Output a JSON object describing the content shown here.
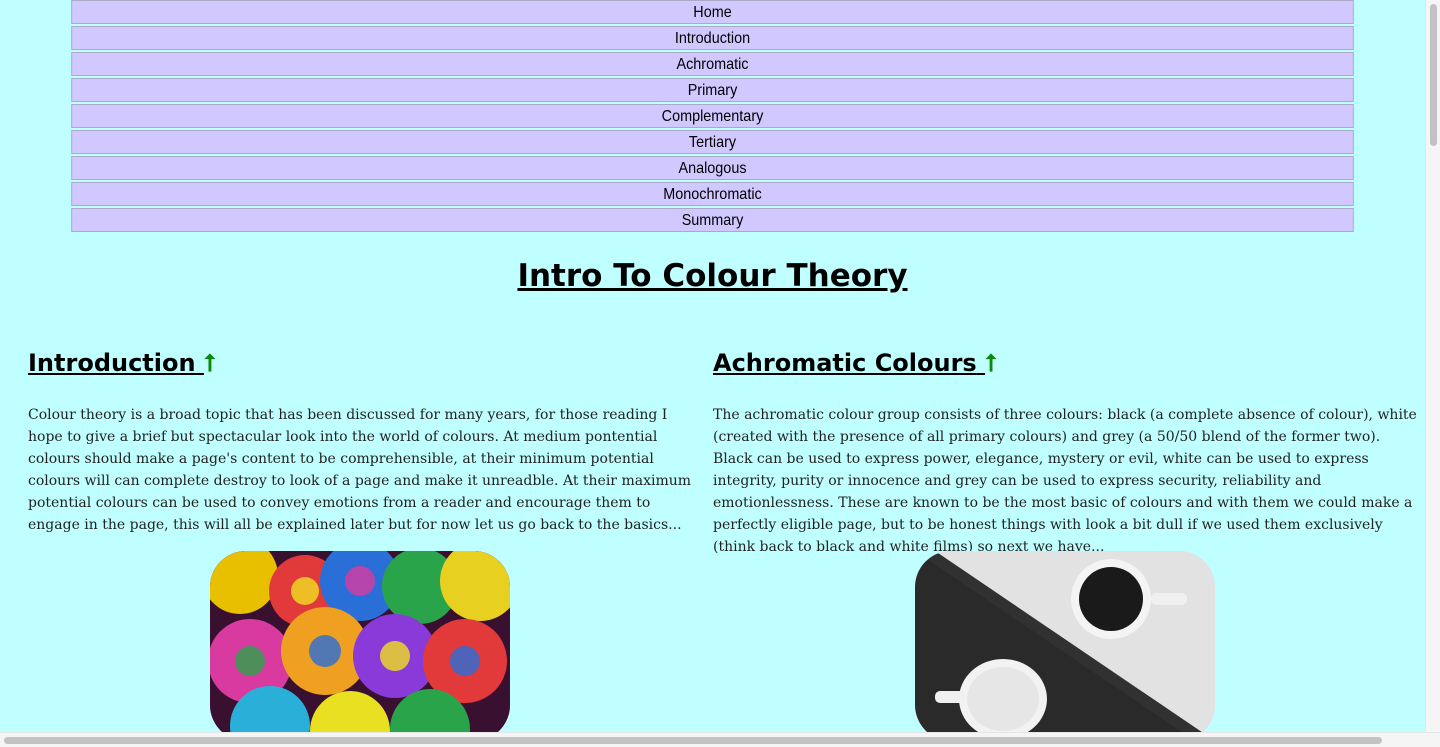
{
  "nav": {
    "items": [
      {
        "label": "Home"
      },
      {
        "label": "Introduction"
      },
      {
        "label": "Achromatic"
      },
      {
        "label": "Primary"
      },
      {
        "label": "Complementary"
      },
      {
        "label": "Tertiary"
      },
      {
        "label": "Analogous"
      },
      {
        "label": "Monochromatic"
      },
      {
        "label": "Summary"
      }
    ]
  },
  "page": {
    "title": "Intro To Colour Theory"
  },
  "sections": [
    {
      "title": "Introduction",
      "arrow": "⭡",
      "text": "Colour theory is a broad topic that has been discussed for many years, for those reading I hope to give a brief but spectacular look into the world of colours. At medium pontential colours should make a page's content to be comprehensible, at their minimum potential colours will can complete destroy to look of a page and make it unreadble. At their maximum potential colours can be used to convey emotions from a reader and encourage them to engage in the page, this will all be explained later but for now let us go back to the basics...",
      "image": "rainbow-roses-image"
    },
    {
      "title": "Achromatic Colours",
      "arrow": "⭡",
      "text": "The achromatic colour group consists of three colours: black (a complete absence of colour), white (created with the presence of all primary colours) and grey (a 50/50 blend of the former two). Black can be used to express power, elegance, mystery or evil, white can be used to express integrity, purity or innocence and grey can be used to express security, reliability and emotionlessness. These are known to be the most basic of colours and with them we could make a perfectly eligible page, but to be honest things with look a bit dull if we used them exclusively (think back to black and white films) so next we have...",
      "image": "coffee-cups-bw-image"
    }
  ],
  "colors": {
    "background": "#c0ffff",
    "nav_background": "#d0c8ff",
    "arrow": "#0a8a0a"
  }
}
